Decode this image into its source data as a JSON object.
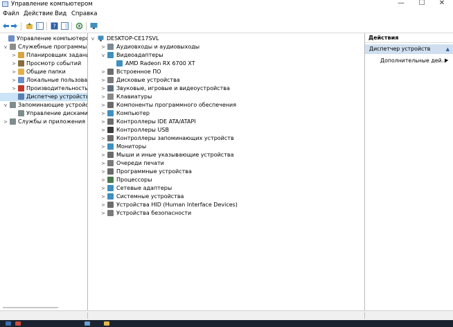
{
  "window": {
    "title": "Управление компьютером",
    "minimize": "—",
    "maximize": "☐",
    "close": "✕"
  },
  "menu": {
    "file": "Файл",
    "action": "Действие",
    "view": "Вид",
    "help": "Справка"
  },
  "left_tree": [
    {
      "label": "Управление компьютером (л",
      "level": 0,
      "chev": "",
      "icon": "computer-management-icon",
      "color": "#6b8fc6"
    },
    {
      "label": "Служебные программы",
      "level": 1,
      "chev": "v",
      "icon": "tools-icon",
      "color": "#8d8d8d"
    },
    {
      "label": "Планировщик заданий",
      "level": 2,
      "chev": ">",
      "icon": "clock-icon",
      "color": "#d9a441"
    },
    {
      "label": "Просмотр событий",
      "level": 2,
      "chev": ">",
      "icon": "event-viewer-icon",
      "color": "#8a6d3b"
    },
    {
      "label": "Общие папки",
      "level": 2,
      "chev": ">",
      "icon": "shared-folder-icon",
      "color": "#e3b04b"
    },
    {
      "label": "Локальные пользовате",
      "level": 2,
      "chev": ">",
      "icon": "users-icon",
      "color": "#6a8ec3"
    },
    {
      "label": "Производительность",
      "level": 2,
      "chev": ">",
      "icon": "performance-icon",
      "color": "#c0392b"
    },
    {
      "label": "Диспетчер устройств",
      "level": 2,
      "chev": "",
      "icon": "device-manager-icon",
      "color": "#5a7fb0",
      "selected": true
    },
    {
      "label": "Запоминающие устройст",
      "level": 1,
      "chev": "v",
      "icon": "storage-icon",
      "color": "#7f8c8d"
    },
    {
      "label": "Управление дисками",
      "level": 2,
      "chev": "",
      "icon": "disk-management-icon",
      "color": "#7f8c8d"
    },
    {
      "label": "Службы и приложения",
      "level": 1,
      "chev": ">",
      "icon": "services-icon",
      "color": "#7f8c8d"
    }
  ],
  "device_tree": {
    "root": "DESKTOP-CE17SVL",
    "items": [
      {
        "label": "Аудиовходы и аудиовыходы",
        "chev": ">",
        "icon": "audio-icon",
        "color": "#7a8a99"
      },
      {
        "label": "Видеоадаптеры",
        "chev": "v",
        "icon": "display-adapter-icon",
        "color": "#3f8fbf"
      },
      {
        "label": "AMD Radeon RX 6700 XT",
        "chev": "",
        "icon": "display-adapter-icon",
        "color": "#3f8fbf",
        "child": true
      },
      {
        "label": "Встроенное ПО",
        "chev": ">",
        "icon": "firmware-icon",
        "color": "#6b6b6b"
      },
      {
        "label": "Дисковые устройства",
        "chev": ">",
        "icon": "disk-drive-icon",
        "color": "#7a7a7a"
      },
      {
        "label": "Звуковые, игровые и видеоустройства",
        "chev": ">",
        "icon": "sound-icon",
        "color": "#5f6f7f"
      },
      {
        "label": "Клавиатуры",
        "chev": ">",
        "icon": "keyboard-icon",
        "color": "#8a8a8a"
      },
      {
        "label": "Компоненты программного обеспечения",
        "chev": ">",
        "icon": "software-component-icon",
        "color": "#6b6b6b"
      },
      {
        "label": "Компьютер",
        "chev": ">",
        "icon": "computer-icon",
        "color": "#3f8fbf"
      },
      {
        "label": "Контроллеры IDE ATA/ATAPI",
        "chev": ">",
        "icon": "ide-controller-icon",
        "color": "#6b6b6b"
      },
      {
        "label": "Контроллеры USB",
        "chev": ">",
        "icon": "usb-icon",
        "color": "#3a3a3a"
      },
      {
        "label": "Контроллеры запоминающих устройств",
        "chev": ">",
        "icon": "storage-controller-icon",
        "color": "#6b6b6b"
      },
      {
        "label": "Мониторы",
        "chev": ">",
        "icon": "monitor-icon",
        "color": "#3f8fbf"
      },
      {
        "label": "Мыши и иные указывающие устройства",
        "chev": ">",
        "icon": "mouse-icon",
        "color": "#6b6b6b"
      },
      {
        "label": "Очереди печати",
        "chev": ">",
        "icon": "printer-icon",
        "color": "#7a7a7a"
      },
      {
        "label": "Программные устройства",
        "chev": ">",
        "icon": "software-device-icon",
        "color": "#6b6b6b"
      },
      {
        "label": "Процессоры",
        "chev": ">",
        "icon": "processor-icon",
        "color": "#4a7a4a"
      },
      {
        "label": "Сетевые адаптеры",
        "chev": ">",
        "icon": "network-adapter-icon",
        "color": "#3f8fbf"
      },
      {
        "label": "Системные устройства",
        "chev": ">",
        "icon": "system-device-icon",
        "color": "#3f8fbf"
      },
      {
        "label": "Устройства HID (Human Interface Devices)",
        "chev": ">",
        "icon": "hid-icon",
        "color": "#6b6b6b"
      },
      {
        "label": "Устройства безопасности",
        "chev": ">",
        "icon": "security-device-icon",
        "color": "#7a7a7a"
      }
    ]
  },
  "actions": {
    "header": "Действия",
    "section": "Диспетчер устройств",
    "section_arrow": "▲",
    "more": "Дополнительные дей...",
    "more_arrow": "▶"
  }
}
